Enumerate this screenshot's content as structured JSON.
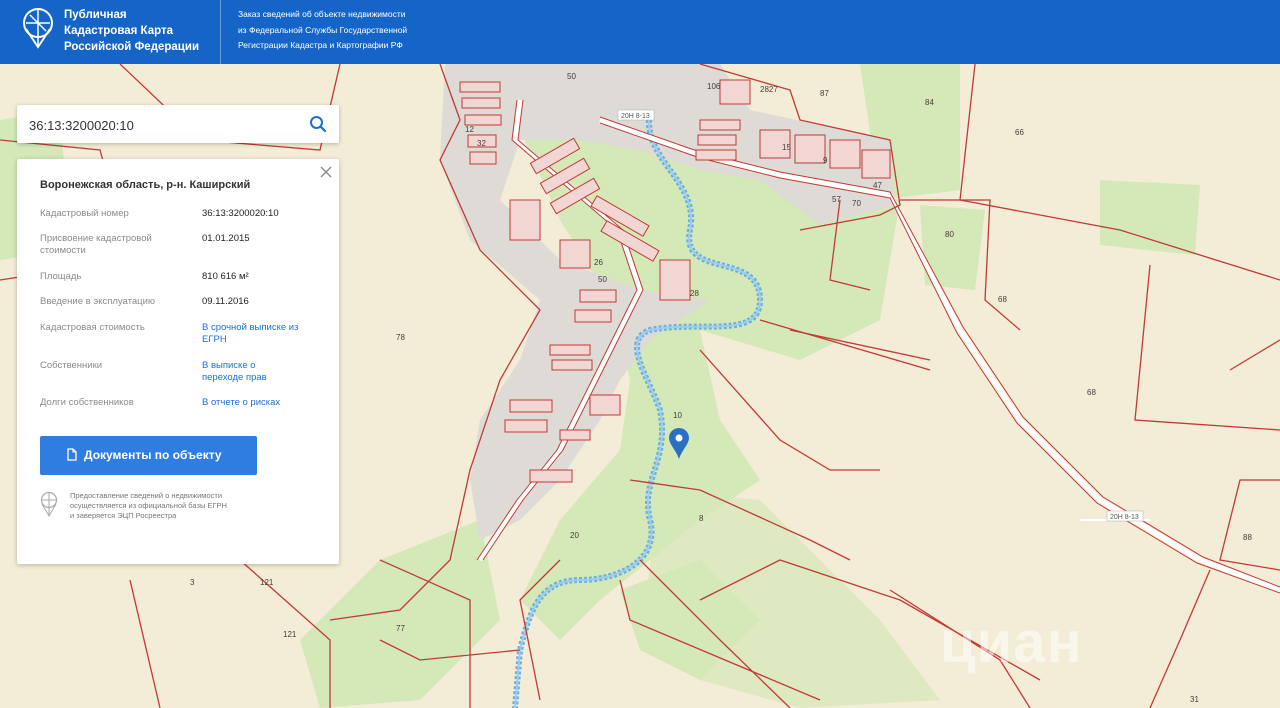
{
  "header": {
    "title_lines": [
      "Публичная",
      "Кадастровая Карта",
      "Российской Федерации"
    ],
    "order_lines": [
      "Заказ сведений об объекте недвижимости",
      "из Федеральной Службы Государственной",
      "Регистрации Кадастра и Картографии РФ"
    ]
  },
  "search": {
    "value": "36:13:3200020:10",
    "icon": "search-icon"
  },
  "card": {
    "region": "Воронежская область, р-н. Каширский",
    "props": [
      {
        "label": "Кадастровый номер",
        "value": "36:13:3200020:10",
        "link": false
      },
      {
        "label": "Присвоение кадастровой стоимости",
        "value": "01.01.2015",
        "link": false
      },
      {
        "label": "Площадь",
        "value": "810 616 м²",
        "link": false
      },
      {
        "label": "Введение в эксплуатацию",
        "value": "09.11.2016",
        "link": false
      },
      {
        "label": "Кадастровая стоимость",
        "value": "В срочной выписке из ЕГРН",
        "link": true
      },
      {
        "label": "Собственники",
        "value": "В выписке о переходе прав",
        "link": true
      },
      {
        "label": "Долги собственников",
        "value": "В отчете о рисках",
        "link": true
      }
    ],
    "doc_button": "Документы по объекту",
    "note_lines": [
      "Предоставление сведений о недвижимости",
      "осуществляется из официальной базы ЕГРН",
      "и заверяется ЭЦП Росреестра"
    ]
  },
  "map": {
    "parcel_labels": [
      "78",
      "87",
      "84",
      "66",
      "80",
      "68",
      "68",
      "10",
      "8",
      "20",
      "3",
      "77",
      "121",
      "121",
      "88",
      "31",
      "106",
      "2827",
      "12",
      "32",
      "26",
      "50",
      "28",
      "15",
      "9",
      "47",
      "57",
      "70",
      "50"
    ],
    "road_labels": [
      "20Н 8-13",
      "20Н 8-13"
    ],
    "watermark": "циан",
    "colors": {
      "parcel_line": "#c03a36",
      "field": "#f3ecd6",
      "green": "#d4e8b8",
      "village": "#dedad6",
      "river": "#6ab0e0",
      "pin": "#2a6fc4"
    }
  }
}
